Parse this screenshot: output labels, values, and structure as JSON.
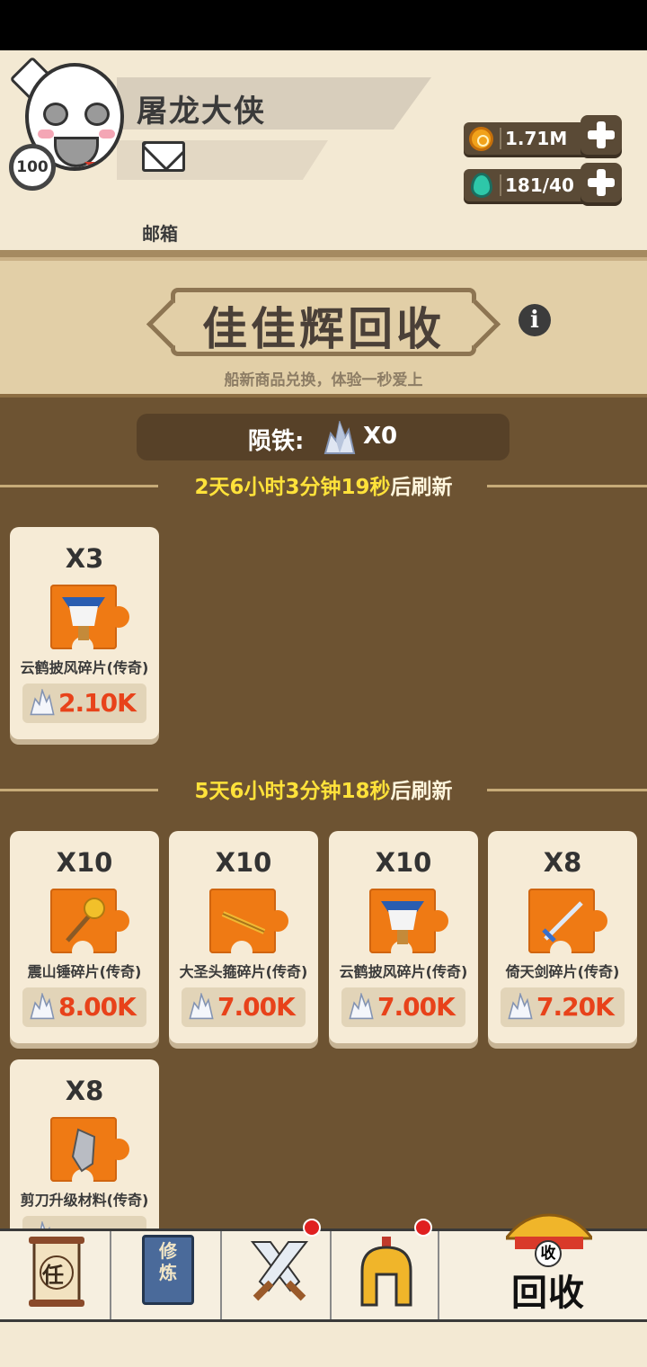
{
  "player": {
    "name": "屠龙大侠",
    "level": "100",
    "mailbox_label": "邮箱"
  },
  "resources": {
    "gold": "1.71M",
    "stamina": "181/40"
  },
  "shop": {
    "title": "佳佳辉回收",
    "subtitle": "船新商品兑换，体验一秒爱上",
    "currency_label": "陨铁:",
    "currency_count": "X0"
  },
  "sections": [
    {
      "timer_value": "2天6小时3分钟19秒",
      "timer_suffix": "后刷新",
      "items": [
        {
          "qty": "X3",
          "name": "云鹤披风碎片(传奇)",
          "price": "2.10K",
          "icon": "cloak-icon"
        }
      ]
    },
    {
      "timer_value": "5天6小时3分钟18秒",
      "timer_suffix": "后刷新",
      "items": [
        {
          "qty": "X10",
          "name": "震山锤碎片(传奇)",
          "price": "8.00K",
          "icon": "hammer-icon"
        },
        {
          "qty": "X10",
          "name": "大圣头箍碎片(传奇)",
          "price": "7.00K",
          "icon": "staff-icon"
        },
        {
          "qty": "X10",
          "name": "云鹤披风碎片(传奇)",
          "price": "7.00K",
          "icon": "cloak-icon"
        },
        {
          "qty": "X8",
          "name": "倚天剑碎片(传奇)",
          "price": "7.20K",
          "icon": "sword-icon"
        },
        {
          "qty": "X8",
          "name": "剪刀升级材料(传奇)",
          "price": "",
          "icon": "ore-icon"
        }
      ]
    }
  ],
  "nav": {
    "task_label": "任",
    "cultivate_label": "修炼",
    "recycle_roof_label": "收",
    "recycle_label": "回收"
  },
  "colors": {
    "accent_yellow": "#ffe23a",
    "price_red": "#e8421a",
    "panel_brown": "#6d5332",
    "card_cream": "#f6ebd6"
  }
}
